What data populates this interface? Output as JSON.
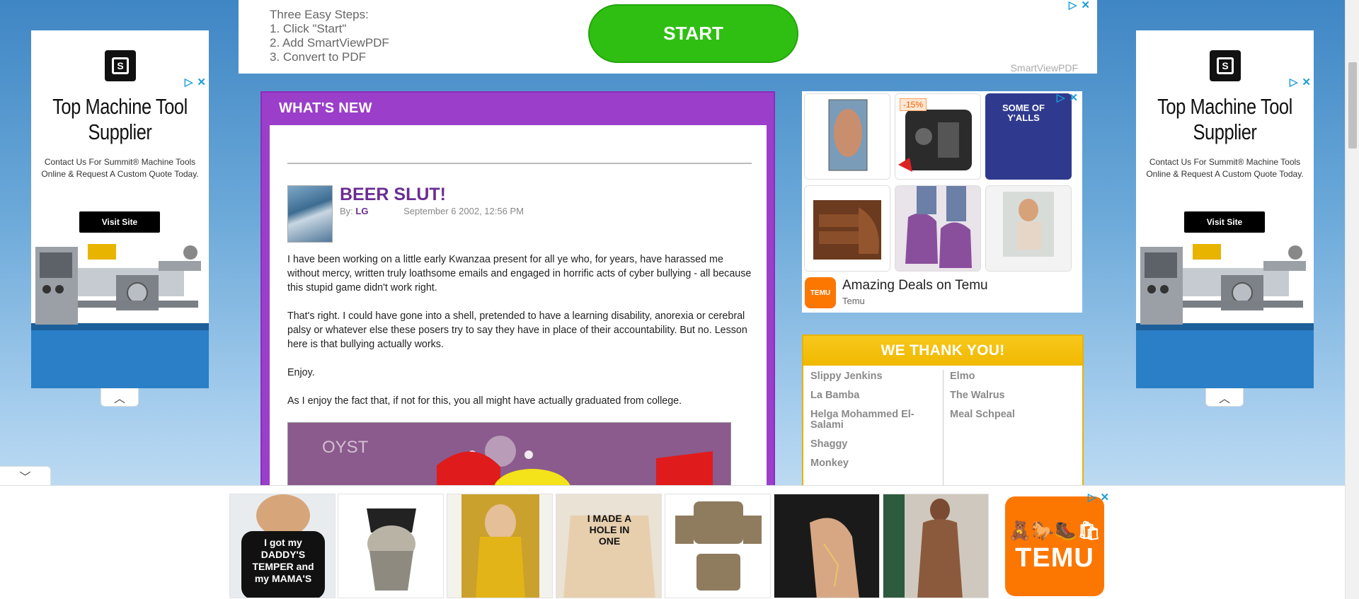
{
  "top_ad": {
    "steps_title": "Three Easy Steps:",
    "steps": [
      "1. Click \"Start\"",
      "2. Add SmartViewPDF",
      "3. Convert to PDF"
    ],
    "cta_label": "START",
    "brand": "SmartViewPDF",
    "adchoice_icon": "ad-info-icon",
    "close_glyph": "✕",
    "info_glyph": "▷"
  },
  "side_ad": {
    "logo_letter": "S",
    "headline_line1": "Top Machine Tool",
    "headline_line2": "Supplier",
    "subtext_line1": "Contact Us For Summit® Machine Tools",
    "subtext_line2": "Online & Request A Custom Quote Today.",
    "cta_label": "Visit Site",
    "collapse_glyph": "︿"
  },
  "news": {
    "section_title": "WHAT'S NEW",
    "post": {
      "title": "BEER SLUT!",
      "by_label": "By:",
      "author": "LG",
      "date": "September 6 2002, 12:56 PM",
      "paragraphs": [
        "I have been working on a little early Kwanzaa present for all ye who, for years, have harassed me without mercy, written truly loathsome emails and engaged in horrific acts of cyber bullying - all because this stupid game didn't work right.",
        "That's right. I could have gone into a shell, pretended to have a learning disability, anorexia or cerebral palsy or whatever else these posers try to say they have in place of their accountability. But no. Lesson here is that bullying actually works.",
        "Enjoy.",
        "As I enjoy the fact that, if not for this, you all might have actually graduated from college."
      ]
    }
  },
  "product_ad": {
    "badge": "-15%",
    "shirt_text": "SOME OF Y'ALLS",
    "title": "Amazing Deals on Temu",
    "brand": "Temu",
    "logo_text": "TEMU"
  },
  "thanks": {
    "title": "WE THANK YOU!",
    "left_names": [
      "Slippy Jenkins",
      "La Bamba",
      "Helga Mohammed El-Salami",
      "Shaggy",
      "Monkey"
    ],
    "right_names": [
      "Elmo",
      "The Walrus",
      "Meal Schpeal"
    ]
  },
  "bottom_ad": {
    "shirt1_text": "I got my DADDY'S TEMPER and my MAMA'S",
    "shirt2_text": "I MADE A HOLE IN ONE",
    "logo_icons": "🧸🐎🥾🛍",
    "logo_text": "TEMU",
    "collapse_glyph": "﹀"
  },
  "colors": {
    "purple": "#9b3ec9",
    "gold": "#f0b800",
    "start_green": "#2fbf12",
    "temu_orange": "#fb7701",
    "adchoice_blue": "#1a9cd8"
  }
}
